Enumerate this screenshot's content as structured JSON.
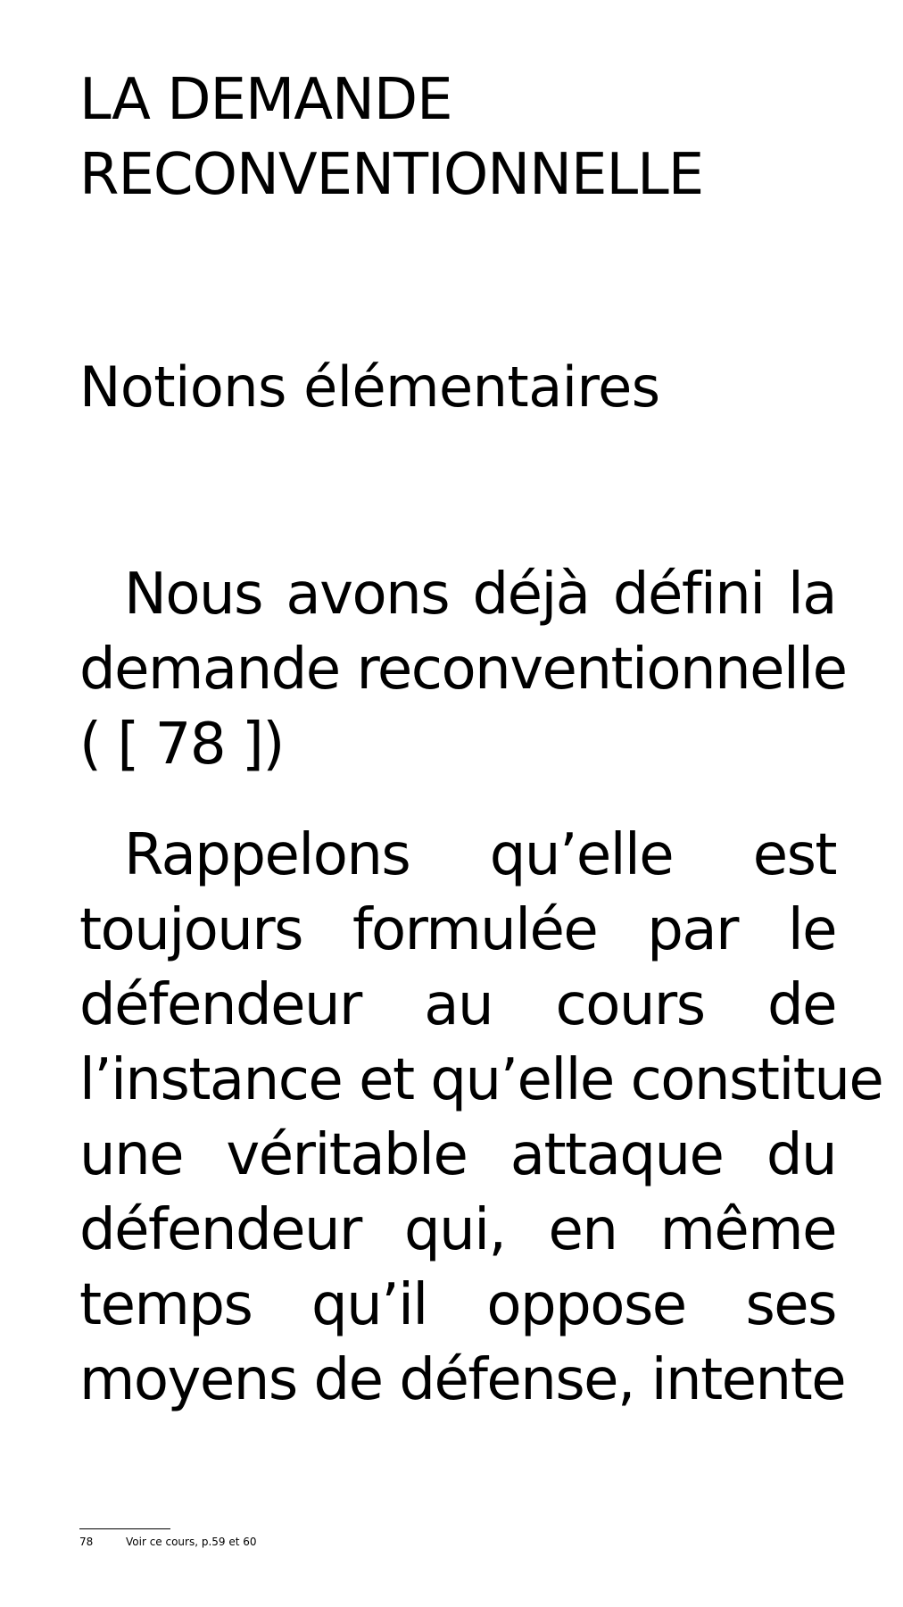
{
  "chapter_title": {
    "line1": "LA DEMANDE",
    "line2": "RECONVENTIONNELLE"
  },
  "section_heading": "Notions élémentaires",
  "paragraph1": {
    "lines": [
      "Nous avons déjà défini la",
      "demande reconventionnelle",
      "( [ 78 ])"
    ]
  },
  "paragraph2": {
    "lines": [
      "Rappelons qu’elle est",
      "toujours formulée par le",
      "défendeur au cours de",
      "l’instance et qu’elle constitue",
      "une véritable attaque du",
      "défendeur qui, en même",
      "temps qu’il oppose ses",
      "moyens de défense, intente"
    ]
  },
  "footnote": {
    "number": "78",
    "text": "Voir ce cours, p.59 et 60"
  }
}
